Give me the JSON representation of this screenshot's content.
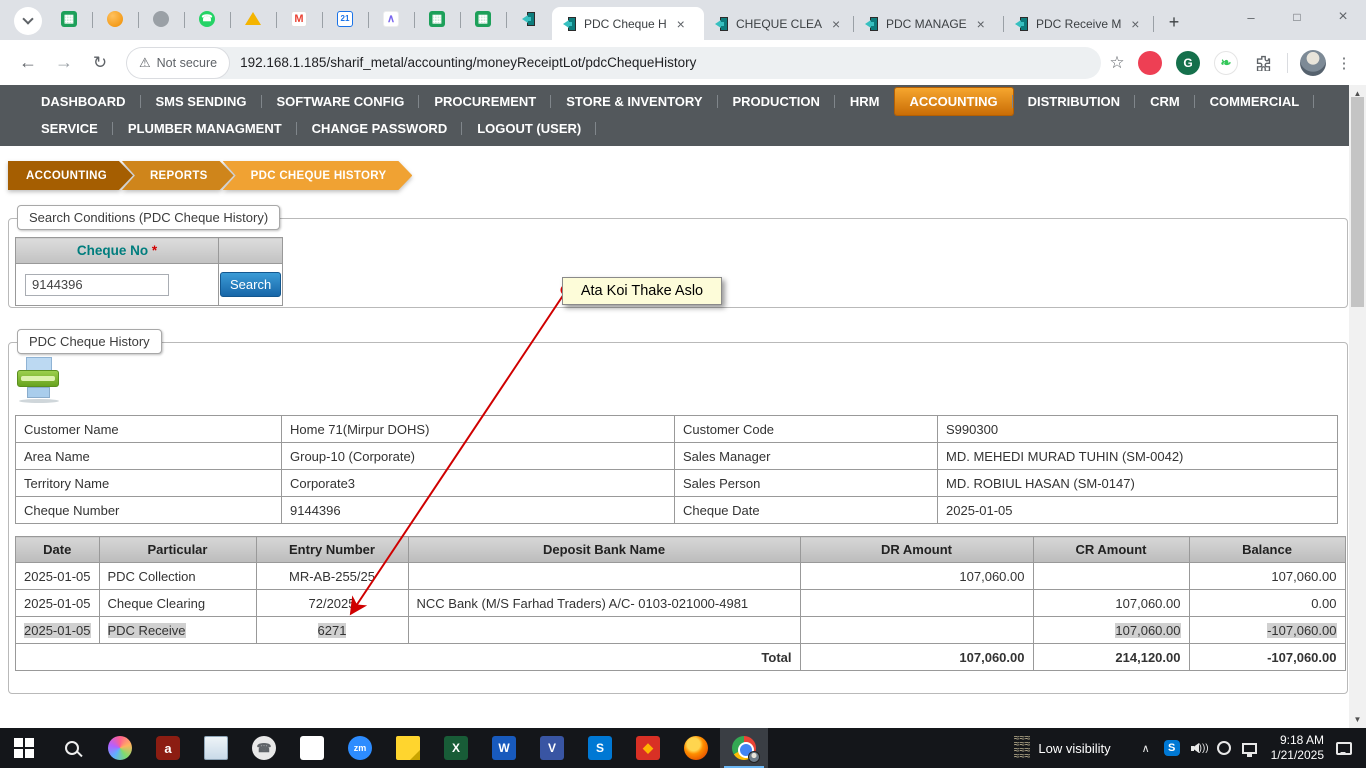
{
  "browser": {
    "tabs": [
      {
        "title": "PDC Cheque H",
        "active": true
      },
      {
        "title": "CHEQUE CLEA",
        "active": false
      },
      {
        "title": "PDC MANAGE",
        "active": false
      },
      {
        "title": "PDC Receive M",
        "active": false
      }
    ],
    "pinned_icons": [
      "sheets",
      "orange-app",
      "globe",
      "whatsapp",
      "drive",
      "gmail",
      "calendar",
      "clickup",
      "sheets",
      "sheets",
      "exit-door"
    ],
    "calendar_day": "21",
    "gmail_letter": "M",
    "grammarly_letter": "G",
    "zoom_label": "zm",
    "excel_letter": "X",
    "word_letter": "W",
    "visio_letter": "V",
    "skype_letter": "S",
    "security_label": "Not secure",
    "url": "192.168.1.185/sharif_metal/accounting/moneyReceiptLot/pdcChequeHistory"
  },
  "nav": {
    "row1": [
      "DASHBOARD",
      "SMS SENDING",
      "SOFTWARE CONFIG",
      "PROCUREMENT",
      "STORE & INVENTORY",
      "PRODUCTION",
      "HRM",
      "ACCOUNTING",
      "DISTRIBUTION",
      "CRM",
      "COMMERCIAL"
    ],
    "row2": [
      "SERVICE",
      "PLUMBER MANAGMENT",
      "CHANGE PASSWORD",
      "LOGOUT (USER)"
    ],
    "active_item": "ACCOUNTING"
  },
  "breadcrumb": {
    "items": [
      "ACCOUNTING",
      "REPORTS",
      "PDC CHEQUE HISTORY"
    ]
  },
  "search_panel": {
    "legend": "Search Conditions (PDC Cheque History)",
    "field_label": "Cheque No",
    "required_mark": "*",
    "value": "9144396",
    "button_label": "Search"
  },
  "annotation": {
    "text": "Ata Koi Thake Aslo"
  },
  "history_panel": {
    "legend": "PDC Cheque History",
    "info_rows": [
      [
        "Customer Name",
        "Home 71(Mirpur DOHS)",
        "Customer Code",
        "S990300"
      ],
      [
        "Area Name",
        "Group-10 (Corporate)",
        "Sales Manager",
        "MD. MEHEDI MURAD TUHIN (SM-0042)"
      ],
      [
        "Territory Name",
        "Corporate3",
        "Sales Person",
        "MD. ROBIUL HASAN (SM-0147)"
      ],
      [
        "Cheque Number",
        "9144396",
        "Cheque Date",
        "2025-01-05"
      ]
    ],
    "table": {
      "headers": [
        "Date",
        "Particular",
        "Entry Number",
        "Deposit Bank Name",
        "DR Amount",
        "CR Amount",
        "Balance"
      ],
      "rows": [
        {
          "date": "2025-01-05",
          "particular": "PDC Collection",
          "entry": "MR-AB-255/25",
          "bank": "",
          "dr": "107,060.00",
          "cr": "",
          "bal": "107,060.00"
        },
        {
          "date": "2025-01-05",
          "particular": "Cheque Clearing",
          "entry": "72/2025",
          "bank": "NCC Bank (M/S Farhad Traders) A/C- 0103-021000-4981",
          "dr": "",
          "cr": "107,060.00",
          "bal": "0.00"
        },
        {
          "date": "2025-01-05",
          "particular": "PDC Receive",
          "entry": "6271",
          "bank": "",
          "dr": "",
          "cr": "107,060.00",
          "bal": "-107,060.00"
        }
      ],
      "selected_row_index": 2,
      "total": {
        "label": "Total",
        "dr": "107,060.00",
        "cr": "214,120.00",
        "bal": "-107,060.00"
      }
    },
    "colors": {
      "accent_orange": "#f0a233",
      "menu_dark": "#53585c",
      "label_teal": "#007d7d",
      "arrow_red": "#cf0000",
      "selection_gray": "#d0d0d0"
    }
  },
  "taskbar": {
    "weather_label": "Low visibility",
    "time": "9:18 AM",
    "date": "1/21/2025"
  }
}
